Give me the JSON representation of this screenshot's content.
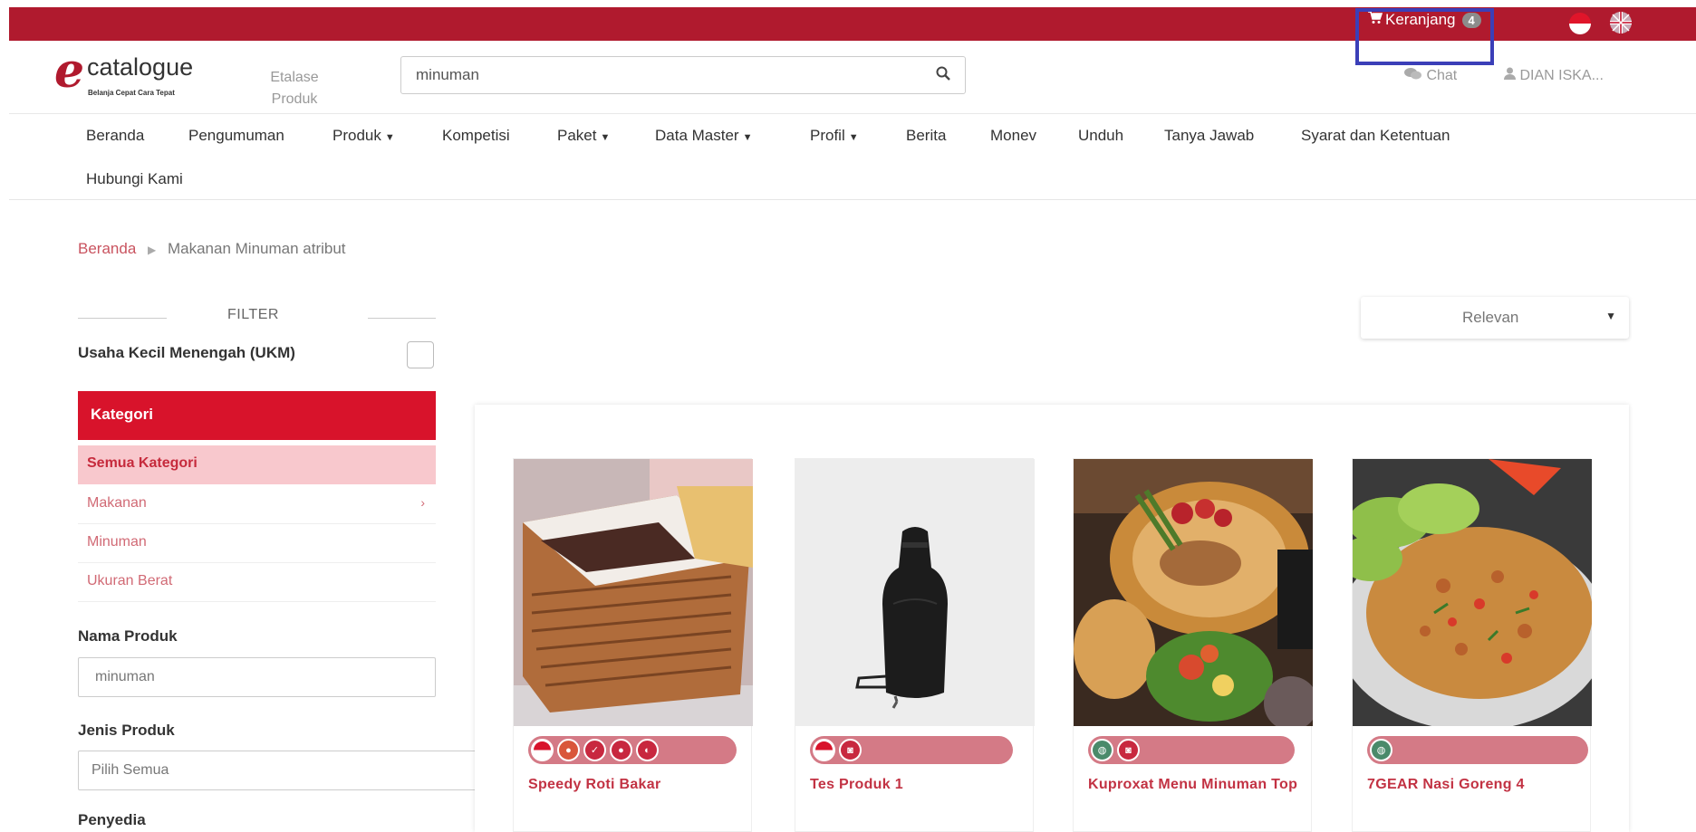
{
  "topbar": {
    "cart_label": "Keranjang",
    "cart_count": "4",
    "flag_id_icon": "indonesia-flag-icon",
    "flag_uk_icon": "uk-flag-icon",
    "bar_color": "#b01a2e"
  },
  "header": {
    "logo_name": "catalogue",
    "logo_tagline": "Belanja Cepat Cara Tepat",
    "etalase_label": "Etalase Produk",
    "search_value": "minuman",
    "chat_label": "Chat",
    "user_label": "DIAN ISKA..."
  },
  "nav": {
    "items": [
      {
        "label": "Beranda"
      },
      {
        "label": "Pengumuman"
      },
      {
        "label": "Produk",
        "dropdown": true
      },
      {
        "label": "Kompetisi"
      },
      {
        "label": "Paket",
        "dropdown": true
      },
      {
        "label": "Data Master",
        "dropdown": true
      },
      {
        "label": "Profil",
        "dropdown": true
      },
      {
        "label": "Berita"
      },
      {
        "label": "Monev"
      },
      {
        "label": "Unduh"
      },
      {
        "label": "Tanya Jawab"
      },
      {
        "label": "Syarat dan Ketentuan"
      },
      {
        "label": "Hubungi Kami"
      }
    ]
  },
  "breadcrumb": {
    "home": "Beranda",
    "current": "Makanan Minuman atribut"
  },
  "sidebar": {
    "filter_title": "FILTER",
    "ukm_label": "Usaha Kecil Menengah (UKM)",
    "kategori_title": "Kategori",
    "categories": [
      {
        "label": "Semua Kategori",
        "active": true
      },
      {
        "label": "Makanan",
        "has_children": true
      },
      {
        "label": "Minuman"
      },
      {
        "label": "Ukuran Berat"
      }
    ],
    "nama_produk_label": "Nama Produk",
    "nama_produk_value": "minuman",
    "jenis_produk_label": "Jenis Produk",
    "jenis_produk_value": "Pilih Semua",
    "penyedia_label": "Penyedia"
  },
  "sort": {
    "selected": "Relevan"
  },
  "products": [
    {
      "name": "Speedy Roti Bakar",
      "badges": [
        "indonesia-flag-icon",
        "local-product-icon",
        "check-icon",
        "domestic-icon",
        "tkdn-icon"
      ]
    },
    {
      "name": "Tes Produk 1",
      "badges": [
        "indonesia-flag-icon",
        "ukm-icon"
      ]
    },
    {
      "name": "Kuproxat Menu Minuman Top",
      "badges": [
        "globe-icon",
        "ukm-icon"
      ]
    },
    {
      "name": "7GEAR Nasi Goreng 4",
      "badges": [
        "globe-icon"
      ]
    }
  ]
}
